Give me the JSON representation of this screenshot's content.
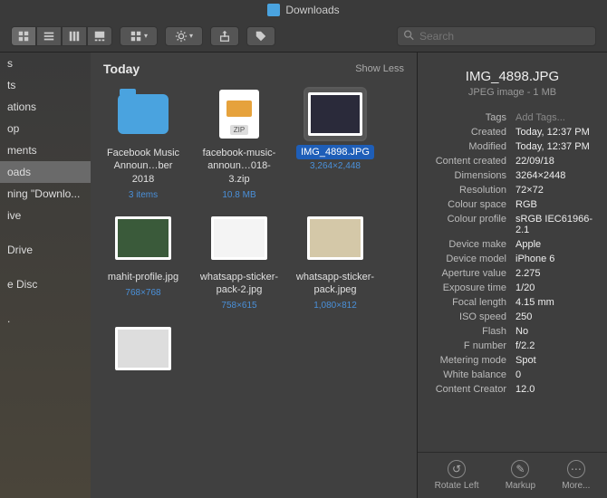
{
  "title": "Downloads",
  "search": {
    "placeholder": "Search"
  },
  "sidebar": {
    "items": [
      "s",
      "ts",
      "ations",
      "op",
      "ments",
      "oads",
      "ning \"Downlo...",
      "ive",
      "",
      "Drive",
      "",
      "e Disc",
      "",
      "."
    ]
  },
  "section": {
    "heading": "Today",
    "toggle": "Show Less"
  },
  "files": [
    {
      "name": "Facebook Music Announ…ber 2018",
      "meta": "3 items",
      "type": "folder",
      "sel": false
    },
    {
      "name": "facebook-music-announ…018-3.zip",
      "meta": "10.8 MB",
      "type": "zip",
      "sel": false
    },
    {
      "name": "IMG_4898.JPG",
      "meta": "3,264×2,448",
      "type": "img",
      "sel": true,
      "bg": "#2a2a3a"
    },
    {
      "name": "mahit-profile.jpg",
      "meta": "768×768",
      "type": "img",
      "sel": false,
      "bg": "#3a5a3a"
    },
    {
      "name": "whatsapp-sticker-pack-2.jpg",
      "meta": "758×615",
      "type": "img",
      "sel": false,
      "bg": "#f4f4f4"
    },
    {
      "name": "whatsapp-sticker-pack.jpeg",
      "meta": "1,080×812",
      "type": "img",
      "sel": false,
      "bg": "#d4c8a8"
    },
    {
      "name": "",
      "meta": "",
      "type": "img",
      "sel": false,
      "bg": "#ddd"
    }
  ],
  "info": {
    "name": "IMG_4898.JPG",
    "kind": "JPEG image - 1 MB",
    "rows": [
      {
        "k": "Tags",
        "v": "Add Tags...",
        "dim": true
      },
      {
        "k": "Created",
        "v": "Today, 12:37 PM"
      },
      {
        "k": "Modified",
        "v": "Today, 12:37 PM"
      },
      {
        "k": "Content created",
        "v": "22/09/18"
      },
      {
        "k": "Dimensions",
        "v": "3264×2448"
      },
      {
        "k": "Resolution",
        "v": "72×72"
      },
      {
        "k": "Colour space",
        "v": "RGB"
      },
      {
        "k": "Colour profile",
        "v": "sRGB IEC61966-2.1"
      },
      {
        "k": "Device make",
        "v": "Apple"
      },
      {
        "k": "Device model",
        "v": "iPhone 6"
      },
      {
        "k": "Aperture value",
        "v": "2.275"
      },
      {
        "k": "Exposure time",
        "v": "1/20"
      },
      {
        "k": "Focal length",
        "v": "4.15 mm"
      },
      {
        "k": "ISO speed",
        "v": "250"
      },
      {
        "k": "Flash",
        "v": "No"
      },
      {
        "k": "F number",
        "v": "f/2.2"
      },
      {
        "k": "Metering mode",
        "v": "Spot"
      },
      {
        "k": "White balance",
        "v": "0"
      },
      {
        "k": "Content Creator",
        "v": "12.0"
      }
    ]
  },
  "actions": [
    {
      "label": "Rotate Left",
      "icon": "↺"
    },
    {
      "label": "Markup",
      "icon": "✎"
    },
    {
      "label": "More...",
      "icon": "⋯"
    }
  ]
}
